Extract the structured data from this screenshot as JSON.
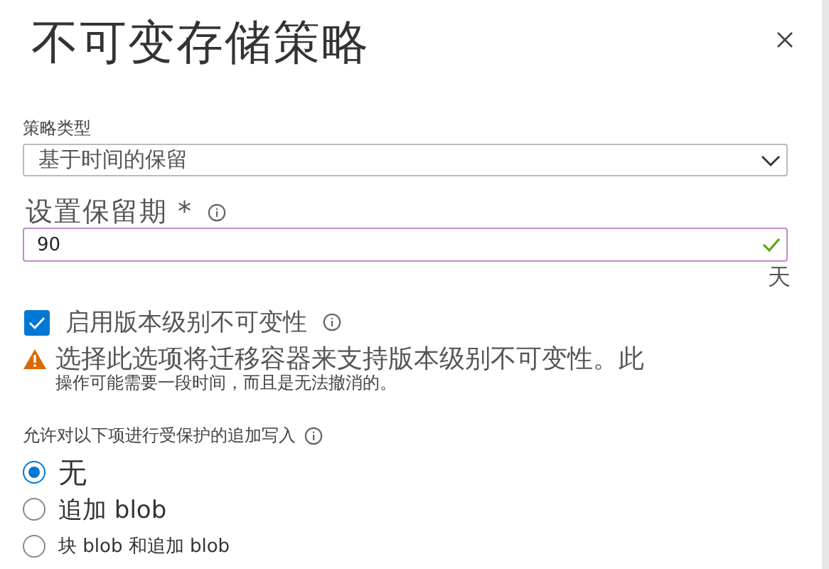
{
  "title": "不可变存储策略",
  "policy_type": {
    "label": "策略类型",
    "value": "基于时间的保留"
  },
  "retention": {
    "label": "设置保留期 *",
    "value": "90",
    "valid": true,
    "unit": "天"
  },
  "version_immutability": {
    "label": "启用版本级别不可变性",
    "checked": true
  },
  "warning": {
    "lines": [
      "选择此选项将迁移容器来支持版本级别不可变性。此",
      "操作可能需要一段时间，而且是无法撤消的。"
    ]
  },
  "append_writes": {
    "label": "允许对以下项进行受保护的追加写入",
    "options": [
      {
        "label": "无",
        "selected": true
      },
      {
        "label": "追加 blob",
        "selected": false
      },
      {
        "label": "块 blob 和追加 blob",
        "selected": false
      }
    ]
  }
}
